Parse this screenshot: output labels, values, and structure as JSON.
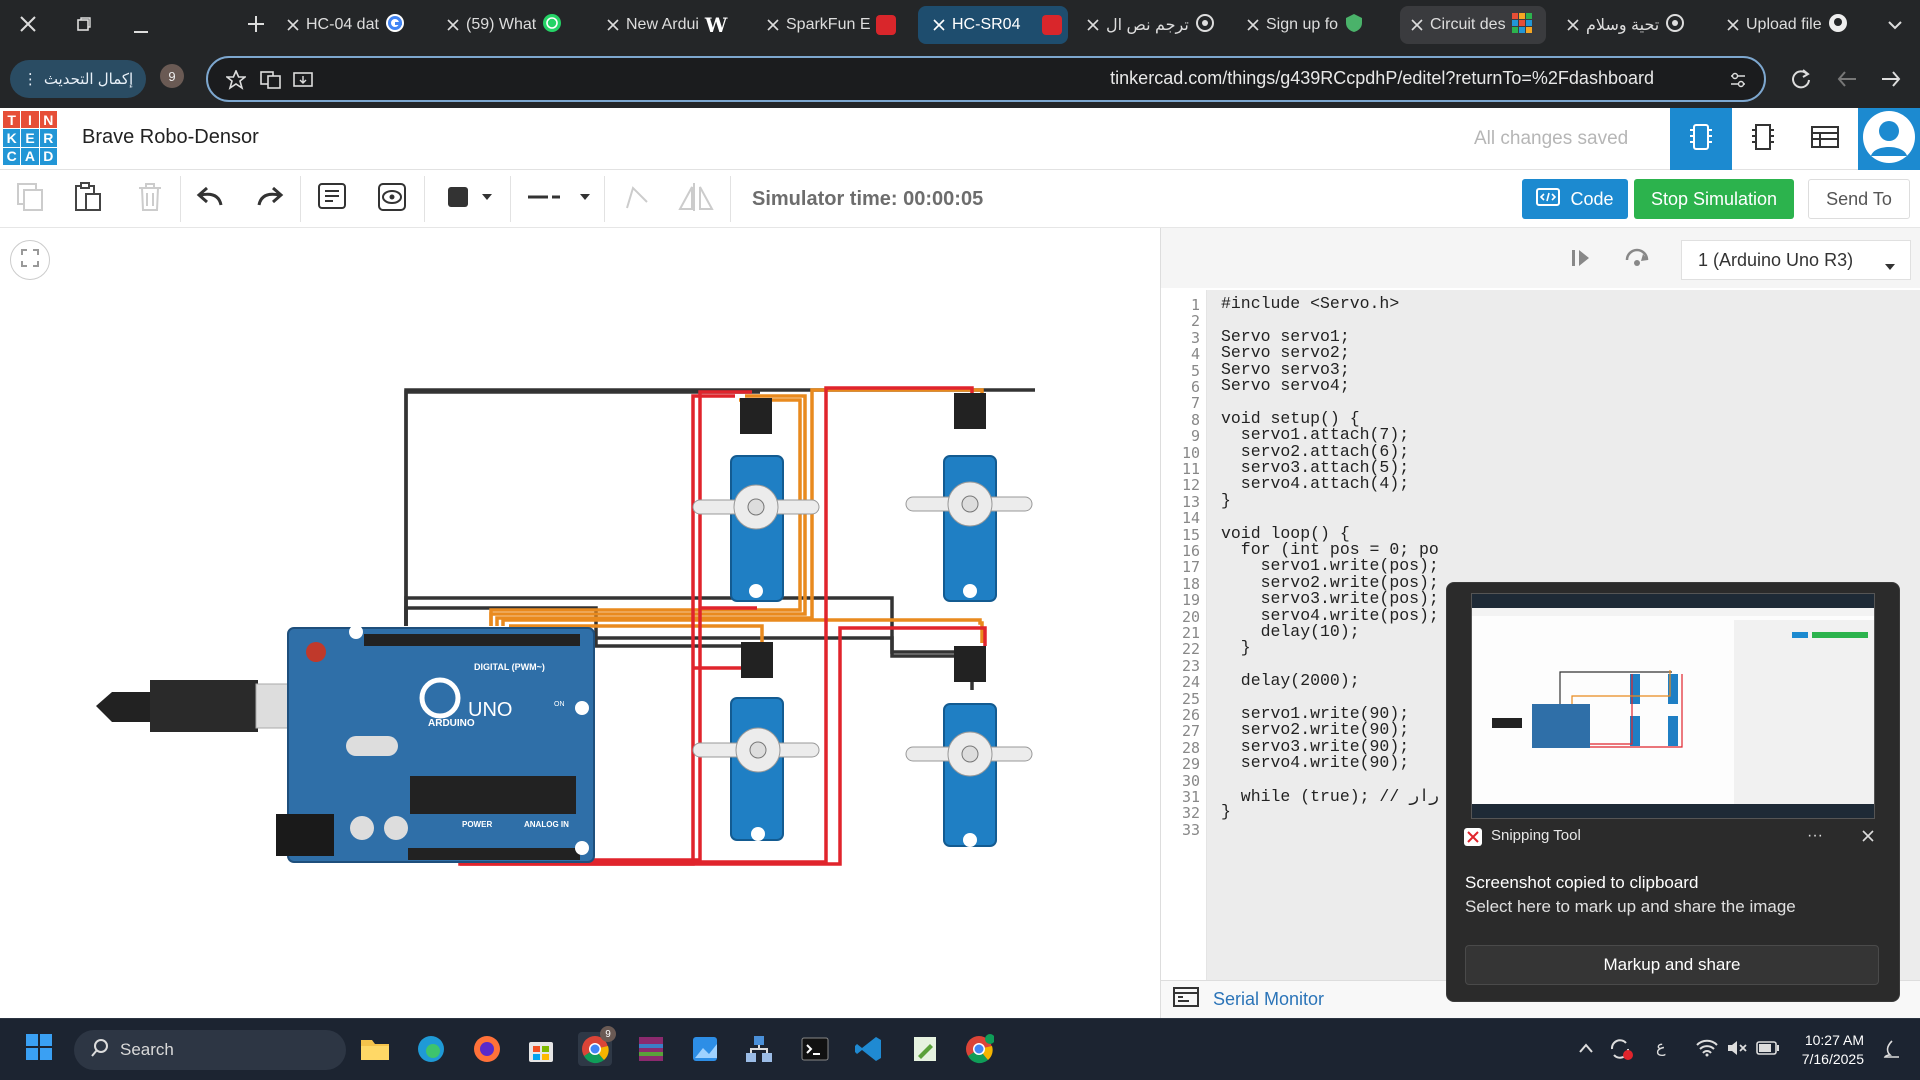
{
  "browser": {
    "tabs": [
      {
        "title": "HC-04 dat",
        "icon": "google-icon",
        "active": false
      },
      {
        "title": "(59) What",
        "icon": "whatsapp-icon",
        "active": false
      },
      {
        "title": "New Ardui",
        "icon": "wikipedia-icon",
        "active": false
      },
      {
        "title": "SparkFun E",
        "icon": "pdf-icon",
        "active": false
      },
      {
        "title": "HC-SR04",
        "icon": "pdf-icon",
        "active": true
      },
      {
        "title": "ترجم نص ال",
        "icon": "openai-icon",
        "active": false
      },
      {
        "title": "Sign up fo",
        "icon": "shield-icon",
        "active": false
      },
      {
        "title": "Circuit des",
        "icon": "tinkercad-icon",
        "active": false
      },
      {
        "title": "تحية وسلام",
        "icon": "openai-icon",
        "active": false
      },
      {
        "title": "Upload file",
        "icon": "github-icon",
        "active": false
      }
    ],
    "update_button": "إكمال التحديث",
    "profile_badge": "9",
    "url": "tinkercad.com/things/g439RCcpdhP/editel?returnTo=%2Fdashboard"
  },
  "app": {
    "logo_letters": [
      "T",
      "I",
      "N",
      "K",
      "E",
      "R",
      "C",
      "A",
      "D"
    ],
    "logo_colors": [
      "#e64e37",
      "#e64e37",
      "#e64e37",
      "#2296d6",
      "#2296d6",
      "#2296d6",
      "#2296d6",
      "#2296d6",
      "#2296d6"
    ],
    "project_title": "Brave Robo-Densor",
    "save_status": "All changes saved"
  },
  "toolbar": {
    "sim_time": "Simulator time: 00:00:05",
    "code_label": "Code",
    "stop_label": "Stop Simulation",
    "send_label": "Send To"
  },
  "code_panel": {
    "board_select": "1 (Arduino Uno R3)",
    "serial_monitor": "Serial Monitor",
    "lines": [
      "#include <Servo.h>",
      "",
      "Servo servo1;",
      "Servo servo2;",
      "Servo servo3;",
      "Servo servo4;",
      "",
      "void setup() {",
      "  servo1.attach(7);",
      "  servo2.attach(6);",
      "  servo3.attach(5);",
      "  servo4.attach(4);",
      "}",
      "",
      "void loop() {",
      "  for (int pos = 0; po",
      "    servo1.write(pos);",
      "    servo2.write(pos);",
      "    servo3.write(pos);",
      "    servo4.write(pos);",
      "    delay(10);",
      "  }",
      "",
      "  delay(2000);",
      "",
      "  servo1.write(90);",
      "  servo2.write(90);",
      "  servo3.write(90);",
      "  servo4.write(90);",
      "",
      "  while (true); // رار",
      "}",
      ""
    ]
  },
  "board_labels": {
    "digital": "DIGITAL (PWM~)",
    "brand": "ARDUINO",
    "model": "UNO",
    "power": "POWER",
    "analog": "ANALOG IN",
    "on": "ON"
  },
  "snipping": {
    "app_name": "Snipping Tool",
    "title": "Screenshot copied to clipboard",
    "subtitle": "Select here to mark up and share the image",
    "button": "Markup and share"
  },
  "taskbar": {
    "search": "Search",
    "chrome_badge": "9",
    "lang": "ع",
    "time": "10:27 AM",
    "date": "7/16/2025"
  }
}
